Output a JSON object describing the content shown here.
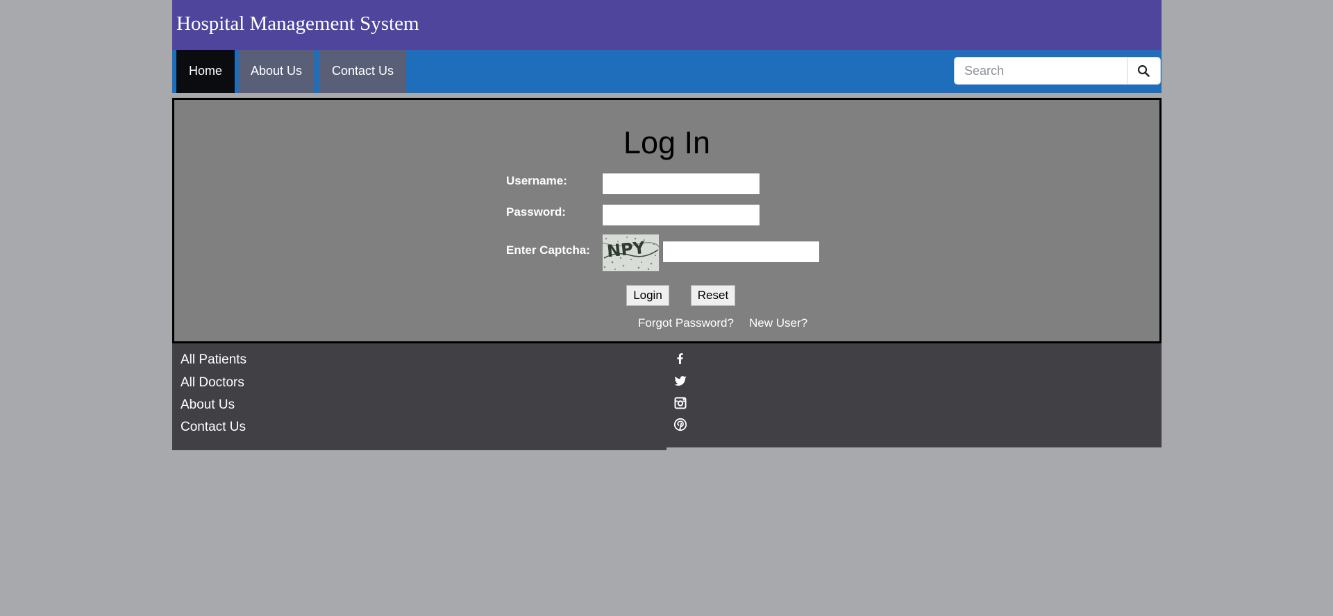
{
  "header": {
    "title": "Hospital Management System"
  },
  "nav": {
    "items": [
      {
        "label": "Home",
        "active": true
      },
      {
        "label": "About Us",
        "active": false
      },
      {
        "label": "Contact Us",
        "active": false
      }
    ],
    "search": {
      "placeholder": "Search",
      "value": "",
      "icon": "search-icon"
    }
  },
  "login": {
    "title": "Log In",
    "username_label": "Username:",
    "username_value": "",
    "password_label": "Password:",
    "password_value": "",
    "captcha_label": "Enter Captcha:",
    "captcha_text": "NPY",
    "captcha_value": "",
    "login_button": "Login",
    "reset_button": "Reset",
    "forgot_link": "Forgot Password?",
    "new_user_link": "New User?"
  },
  "footer": {
    "links": [
      "All Patients",
      "All Doctors",
      "About Us",
      "Contact Us"
    ],
    "social_icons": [
      "facebook-icon",
      "twitter-icon",
      "instagram-icon",
      "pinterest-icon"
    ]
  },
  "colors": {
    "page_background": "#a8a9ac",
    "header": "#4f459c",
    "navbar": "#1e6ebb",
    "nav_active": "#0b0c10",
    "nav_inactive": "#5a5f78",
    "login_panel": "#808080",
    "footer": "#404045"
  }
}
